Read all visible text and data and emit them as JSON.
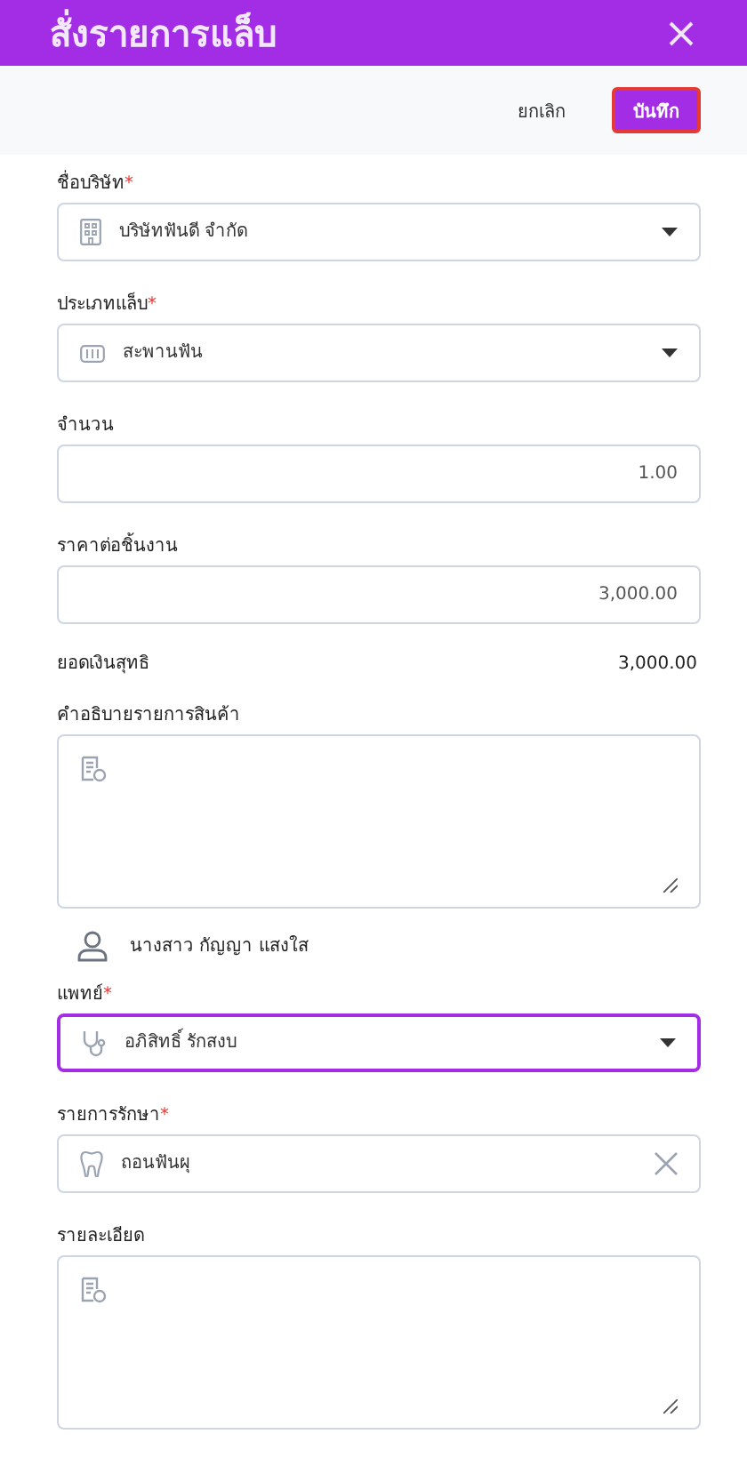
{
  "header": {
    "title": "สั่งรายการแล็บ"
  },
  "toolbar": {
    "cancel": "ยกเลิก",
    "save": "บันทึก",
    "save_focused": true
  },
  "fields": [
    {
      "kind": "select",
      "label": "ชื่อบริษัท",
      "required_mark": "*",
      "value": "บริษัทฟันดี จำกัด",
      "focused": false
    },
    {
      "kind": "select",
      "label": "ประเภทแล็บ",
      "required_mark": "*",
      "value": "สะพานฟัน",
      "focused": false
    },
    {
      "kind": "number",
      "label": "จำนวน",
      "value": "1.00",
      "focused": false
    },
    {
      "kind": "number",
      "label": "ราคาต่อชิ้นงาน",
      "value": "3,000.00",
      "focused": false
    },
    {
      "kind": "total",
      "label": "ยอดเงินสุทธิ",
      "value": "3,000.00"
    },
    {
      "kind": "textarea",
      "label": "คำอธิบายรายการสินค้า",
      "focused": false
    },
    {
      "kind": "person",
      "value": "นางสาว กัญญา แสงใส"
    },
    {
      "kind": "select",
      "label": "แพทย์",
      "required_mark": "*",
      "value": "อภิสิทธิ์ รักสงบ",
      "focused": true
    },
    {
      "kind": "clearable",
      "label": "รายการรักษา",
      "required_mark": "*",
      "value": "ถอนฟันผุ",
      "focused": false
    },
    {
      "kind": "textarea",
      "label": "รายละเอียด",
      "focused": false
    }
  ]
}
